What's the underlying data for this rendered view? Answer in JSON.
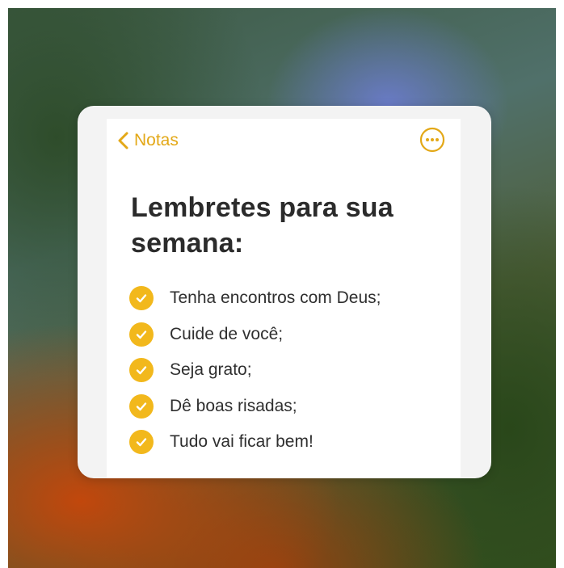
{
  "colors": {
    "accent": "#e3a817",
    "checkbox_fill": "#f2b81c",
    "title_text": "#2b2b2b",
    "card_background": "#ffffff"
  },
  "nav": {
    "back_label": "Notas",
    "back_icon": "chevron-left-icon",
    "more_icon": "ellipsis-circle-icon"
  },
  "note": {
    "title": "Lembretes para sua semana:",
    "items": [
      {
        "text": "Tenha encontros com Deus;",
        "checked": true
      },
      {
        "text": "Cuide de você;",
        "checked": true
      },
      {
        "text": "Seja grato;",
        "checked": true
      },
      {
        "text": "Dê boas risadas;",
        "checked": true
      },
      {
        "text": "Tudo vai ficar bem!",
        "checked": true
      }
    ]
  }
}
